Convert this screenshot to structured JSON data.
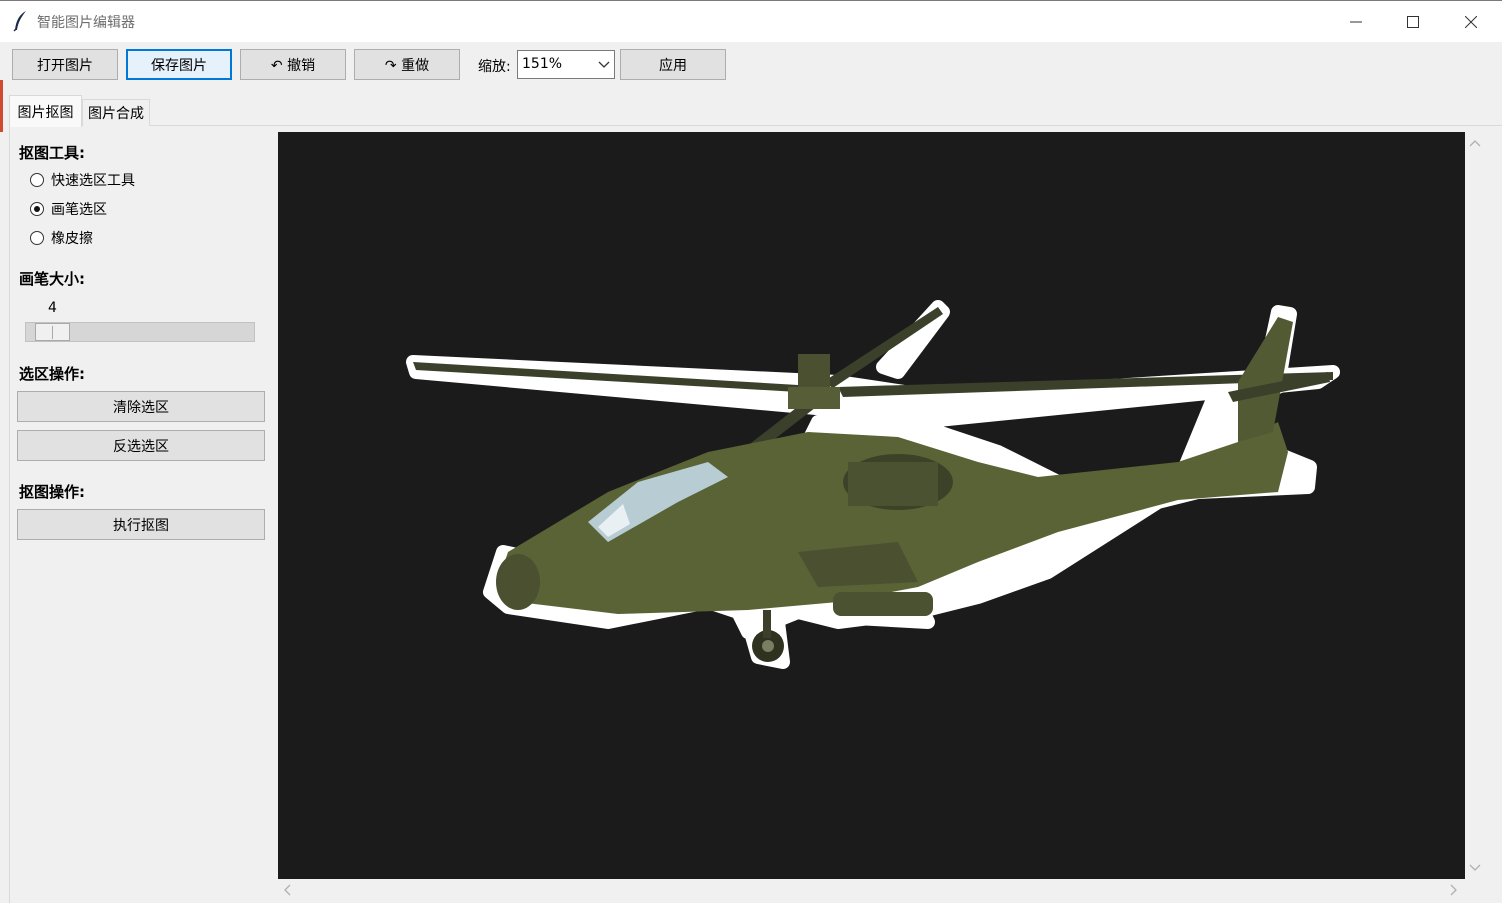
{
  "window": {
    "title": "智能图片编辑器"
  },
  "toolbar": {
    "open": "打开图片",
    "save": "保存图片",
    "undo": "↶ 撤销",
    "redo": "↷ 重做",
    "zoom_label": "缩放:",
    "zoom_value": "151%",
    "apply": "应用"
  },
  "tabs": [
    {
      "label": "图片抠图",
      "active": true
    },
    {
      "label": "图片合成",
      "active": false
    }
  ],
  "sidebar": {
    "tools_title": "抠图工具:",
    "tools": [
      {
        "label": "快速选区工具",
        "checked": false
      },
      {
        "label": "画笔选区",
        "checked": true
      },
      {
        "label": "橡皮擦",
        "checked": false
      }
    ],
    "brush_title": "画笔大小:",
    "brush_value": "4",
    "selection_title": "选区操作:",
    "clear_selection": "清除选区",
    "invert_selection": "反选选区",
    "cutout_title": "抠图操作:",
    "execute_cutout": "执行抠图"
  },
  "colors": {
    "canvas_bg": "#1b1b1b",
    "focus_border": "#0078d7",
    "helicopter_body": "#5a6335",
    "selection_outline": "#ffffff"
  }
}
